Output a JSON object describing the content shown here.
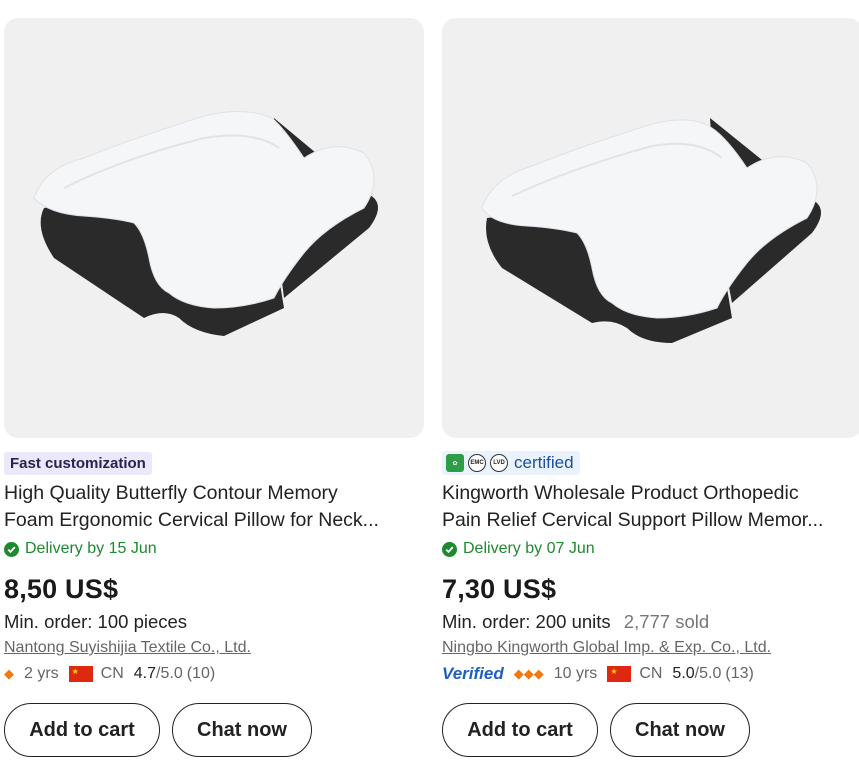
{
  "products": [
    {
      "badge": "Fast customization",
      "title_line1": "High Quality Butterfly Contour Memory",
      "title_line2": "Foam Ergonomic Cervical Pillow for Neck...",
      "delivery": "Delivery by 15 Jun",
      "price": "8,50 US$",
      "min_order": "Min. order: 100 pieces",
      "supplier": "Nantong Suyishijia Textile Co., Ltd.",
      "years": "2 yrs",
      "country": "CN",
      "rating": "4.7",
      "rating_max": "/5.0",
      "reviews": "(10)",
      "add_to_cart": "Add to cart",
      "chat_now": "Chat now"
    },
    {
      "cert_label": "certified",
      "cert_icons": [
        "leaf-cert-icon",
        "EMC",
        "LVD"
      ],
      "title_line1": "Kingworth Wholesale Product Orthopedic",
      "title_line2": "Pain Relief Cervical Support Pillow Memor...",
      "delivery": "Delivery by 07 Jun",
      "price": "7,30 US$",
      "min_order": "Min. order: 200 units",
      "sold": "2,777 sold",
      "supplier": "Ningbo Kingworth Global Imp. & Exp. Co., Ltd.",
      "verified": "Verified",
      "years": "10 yrs",
      "country": "CN",
      "rating": "5.0",
      "rating_max": "/5.0",
      "reviews": "(13)",
      "add_to_cart": "Add to cart",
      "chat_now": "Chat now"
    }
  ],
  "colors": {
    "delivery_green": "#1e8a2e",
    "verified_blue": "#1f5fbf",
    "badge_bg": "#ece8fb",
    "cert_bg": "#eaf2fd"
  }
}
